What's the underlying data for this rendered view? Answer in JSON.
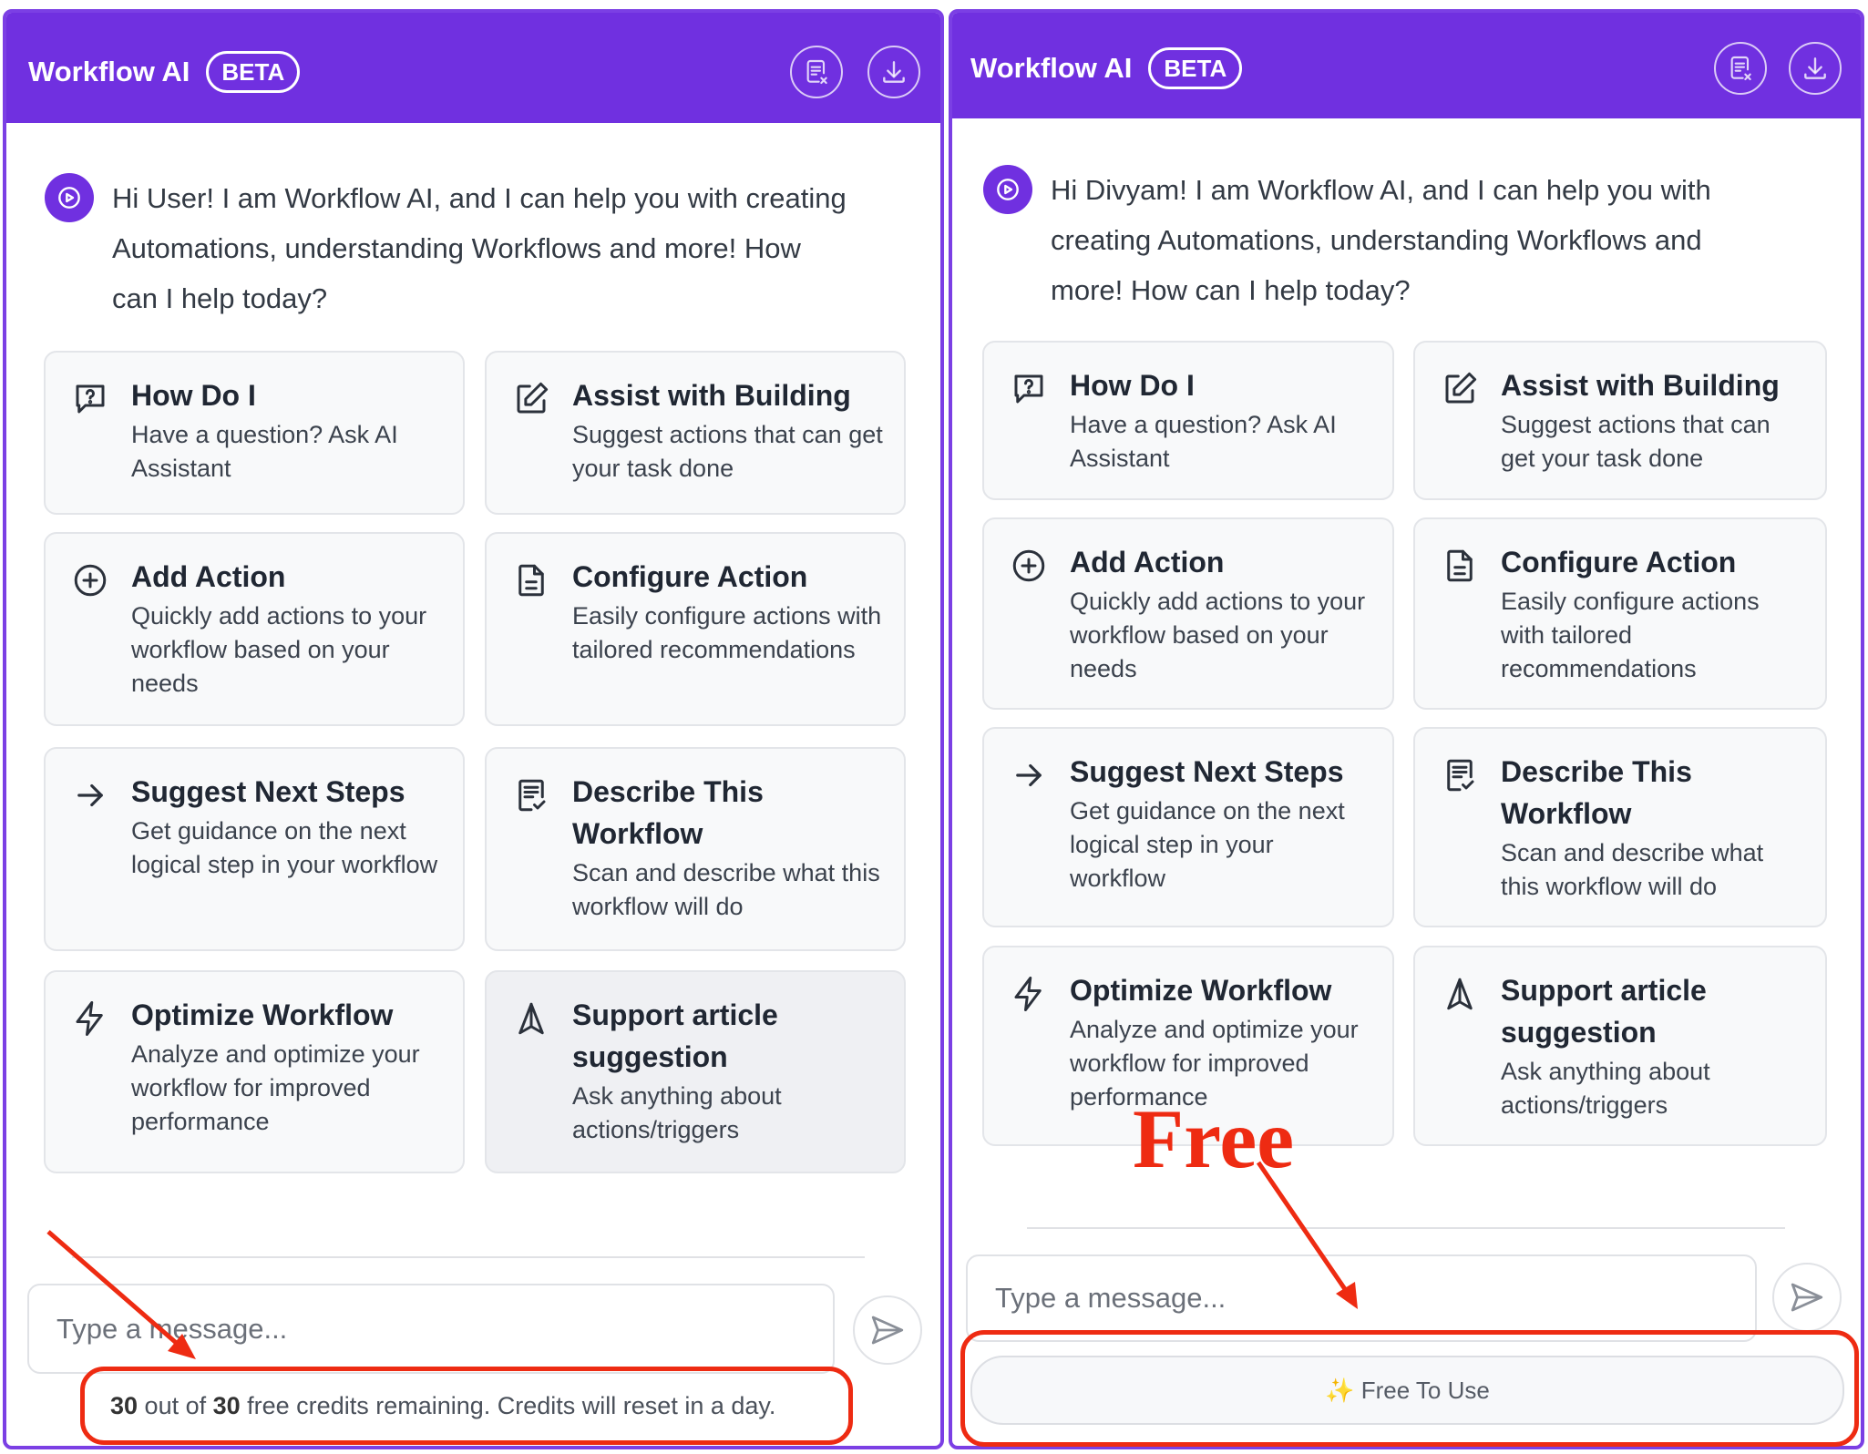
{
  "colors": {
    "brand": "#7030e0",
    "annotation": "#ee2b12"
  },
  "left_panel": {
    "header": {
      "title": "Workflow AI",
      "badge": "BETA",
      "clear_icon": "clear-chat-icon",
      "download_icon": "download-icon"
    },
    "greeting": "Hi User! I am Workflow AI, and I can help you with creating Automations, understanding Workflows and more! How can I help today?",
    "cards": [
      {
        "icon": "question-chat-icon",
        "title": "How Do I",
        "desc": "Have a question? Ask AI Assistant"
      },
      {
        "icon": "edit-icon",
        "title": "Assist with Building",
        "desc": "Suggest actions that can get your task done"
      },
      {
        "icon": "plus-circle-icon",
        "title": "Add Action",
        "desc": "Quickly add actions to your workflow based on your needs"
      },
      {
        "icon": "document-icon",
        "title": "Configure Action",
        "desc": "Easily configure actions with tailored recommendations"
      },
      {
        "icon": "arrow-right-icon",
        "title": "Suggest Next Steps",
        "desc": "Get guidance on the next logical step in your workflow"
      },
      {
        "icon": "checklist-icon",
        "title": "Describe This Workflow",
        "desc": "Scan and describe what this workflow will do"
      },
      {
        "icon": "lightning-icon",
        "title": "Optimize Workflow",
        "desc": "Analyze and optimize your workflow for improved performance"
      },
      {
        "icon": "navigation-icon",
        "title": "Support article suggestion",
        "desc": "Ask anything about actions/triggers"
      }
    ],
    "input": {
      "placeholder": "Type a message..."
    },
    "credits": {
      "used": "30",
      "out_of": " out of ",
      "total": "30",
      "rest": " free credits remaining. Credits will reset in a day."
    }
  },
  "right_panel": {
    "header": {
      "title": "Workflow AI",
      "badge": "BETA",
      "clear_icon": "clear-chat-icon",
      "download_icon": "download-icon"
    },
    "greeting": "Hi Divyam! I am Workflow AI, and I can help you with creating Automations, understanding Workflows and more! How can I help today?",
    "cards": [
      {
        "icon": "question-chat-icon",
        "title": "How Do I",
        "desc": "Have a question? Ask AI Assistant"
      },
      {
        "icon": "edit-icon",
        "title": "Assist with Building",
        "desc": "Suggest actions that can get your task done"
      },
      {
        "icon": "plus-circle-icon",
        "title": "Add Action",
        "desc": "Quickly add actions to your workflow based on your needs"
      },
      {
        "icon": "document-icon",
        "title": "Configure Action",
        "desc": "Easily configure actions with tailored recommendations"
      },
      {
        "icon": "arrow-right-icon",
        "title": "Suggest Next Steps",
        "desc": "Get guidance on the next logical step in your workflow"
      },
      {
        "icon": "checklist-icon",
        "title": "Describe This Workflow",
        "desc": "Scan and describe what this workflow will do"
      },
      {
        "icon": "lightning-icon",
        "title": "Optimize Workflow",
        "desc": "Analyze and optimize your workflow for improved performance"
      },
      {
        "icon": "navigation-icon",
        "title": "Support article suggestion",
        "desc": "Ask anything about actions/triggers"
      }
    ],
    "input": {
      "placeholder": "Type a message..."
    },
    "free_pill": "✨ Free To Use"
  },
  "annotation": {
    "free_label": "Free"
  }
}
